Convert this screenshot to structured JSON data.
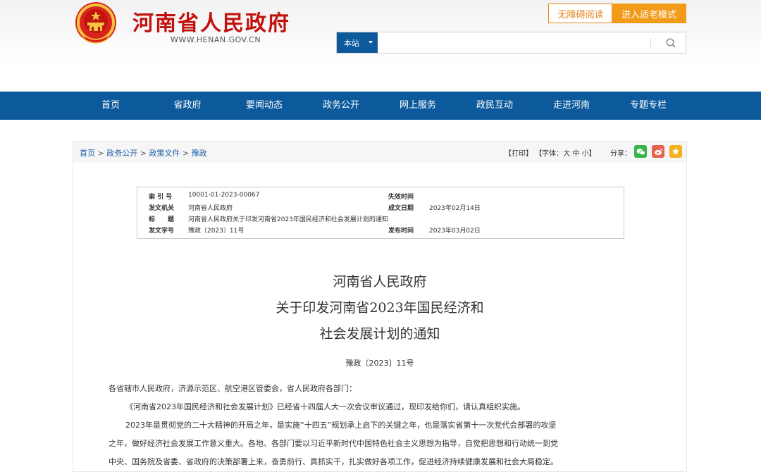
{
  "header": {
    "site_title": "河南省人民政府",
    "site_url": "WWW.HENAN.GOV.CN",
    "accessibility_label": "无障碍阅读",
    "elder_mode_label": "进入适老模式",
    "search": {
      "scope_label": "本站",
      "value": "",
      "placeholder": ""
    },
    "emblem_icon": "national-emblem-icon"
  },
  "nav": {
    "items": [
      "首页",
      "省政府",
      "要闻动态",
      "政务公开",
      "网上服务",
      "政民互动",
      "走进河南",
      "专题专栏"
    ]
  },
  "breadcrumb": [
    "首页",
    "政务公开",
    "政策文件",
    "豫政"
  ],
  "tools": {
    "print": "【打印】",
    "font_prefix": "【字体：",
    "font_large": "大",
    "font_medium": "中",
    "font_small": "小",
    "font_suffix": "】",
    "share_label": "分享：",
    "share_icons": [
      "wechat-icon",
      "weibo-icon",
      "favorite-star-icon"
    ],
    "colors": {
      "wechat": "#38b44a",
      "weibo": "#e5634f",
      "favorite": "#f5b020"
    }
  },
  "info": {
    "index_label": "索 引 号",
    "index_value": "10001-01-2023-00067",
    "expire_label": "失效时间",
    "expire_value": "",
    "issuer_label": "发文机关",
    "issuer_value": "河南省人民政府",
    "written_label": "成文日期",
    "written_value": "2023年02月14日",
    "title_label": "标　　题",
    "title_value": "河南省人民政府关于印发河南省2023年国民经济和社会发展计划的通知",
    "docno_label": "发文字号",
    "docno_value": "豫政〔2023〕11号",
    "published_label": "发布时间",
    "published_value": "2023年03月02日"
  },
  "document": {
    "title_lines": [
      "河南省人民政府",
      "关于印发河南省2023年国民经济和",
      "社会发展计划的通知"
    ],
    "number": "豫政〔2023〕11号",
    "paragraphs": [
      "各省辖市人民政府，济源示范区、航空港区管委会，省人民政府各部门：",
      "《河南省2023年国民经济和社会发展计划》已经省十四届人大一次会议审议通过，现印发给你们，请认真组织实施。",
      "2023年是贯彻党的二十大精神的开局之年，是实施“十四五”规划承上启下的关键之年，也是落实省第十一次党代会部署的攻坚",
      "之年，做好经济社会发展工作意义重大。各地、各部门要以习近平新时代中国特色社会主义思想为指导，自觉把思想和行动统一到党",
      "中央、国务院及省委、省政府的决策部署上来，奋勇前行、真抓实干，扎实做好各项工作，促进经济持续健康发展和社会大局稳定。"
    ]
  },
  "colors": {
    "brand_red": "#c2110e",
    "nav_blue": "#0c5a9c",
    "accent_orange": "#f19b19",
    "link_blue": "#1f5fa8"
  }
}
